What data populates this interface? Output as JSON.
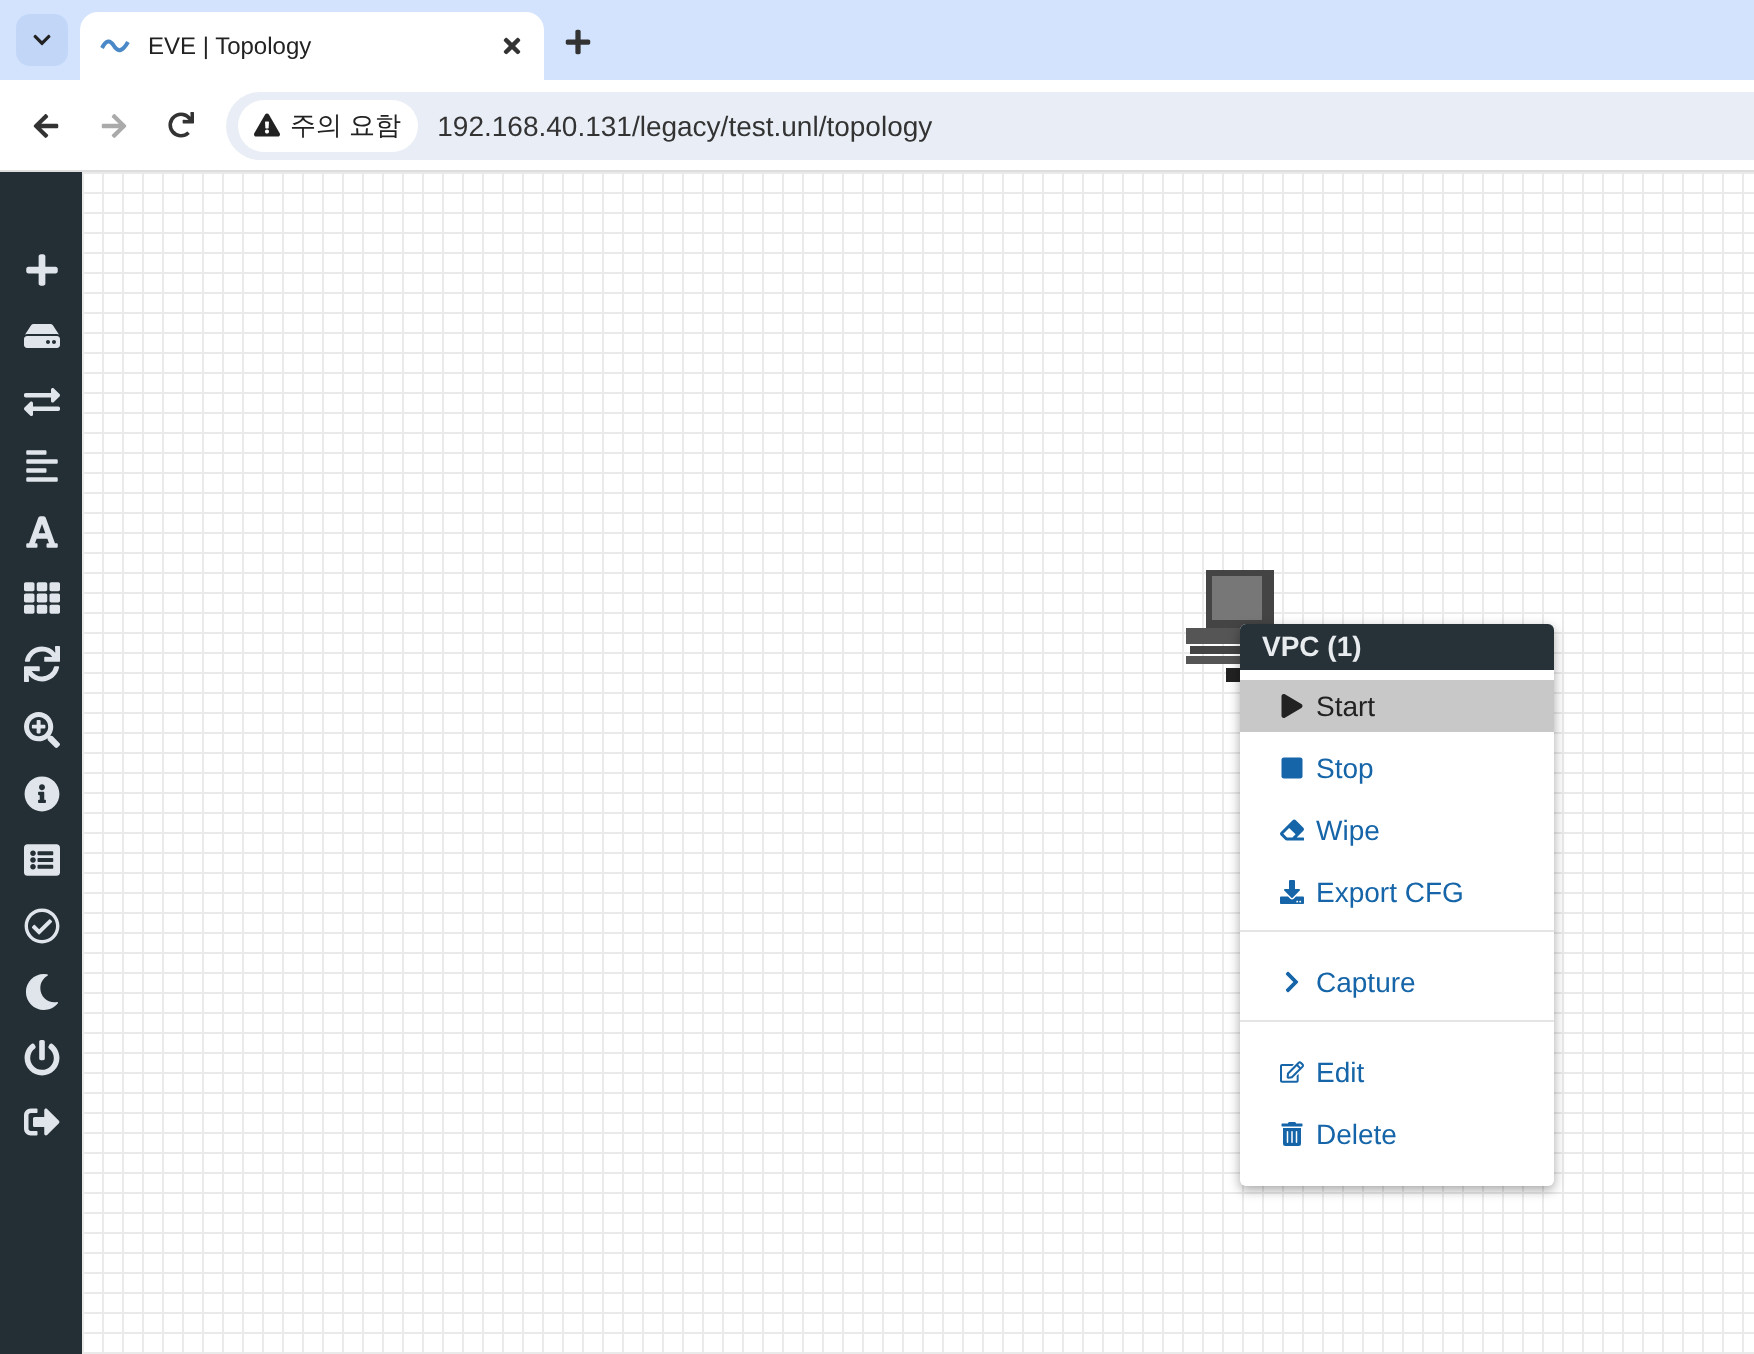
{
  "browser": {
    "tab": {
      "title": "EVE | Topology"
    },
    "security_chip": "주의 요함",
    "url": "192.168.40.131/legacy/test.unl/topology"
  },
  "node": {
    "running": false
  },
  "context_menu": {
    "title": "VPC (1)",
    "groups": [
      [
        {
          "label": "Start",
          "selected": true
        },
        {
          "label": "Stop",
          "selected": false
        },
        {
          "label": "Wipe",
          "selected": false
        },
        {
          "label": "Export CFG",
          "selected": false
        }
      ],
      [
        {
          "label": "Capture",
          "selected": false
        }
      ],
      [
        {
          "label": "Edit",
          "selected": false
        },
        {
          "label": "Delete",
          "selected": false
        }
      ]
    ]
  }
}
